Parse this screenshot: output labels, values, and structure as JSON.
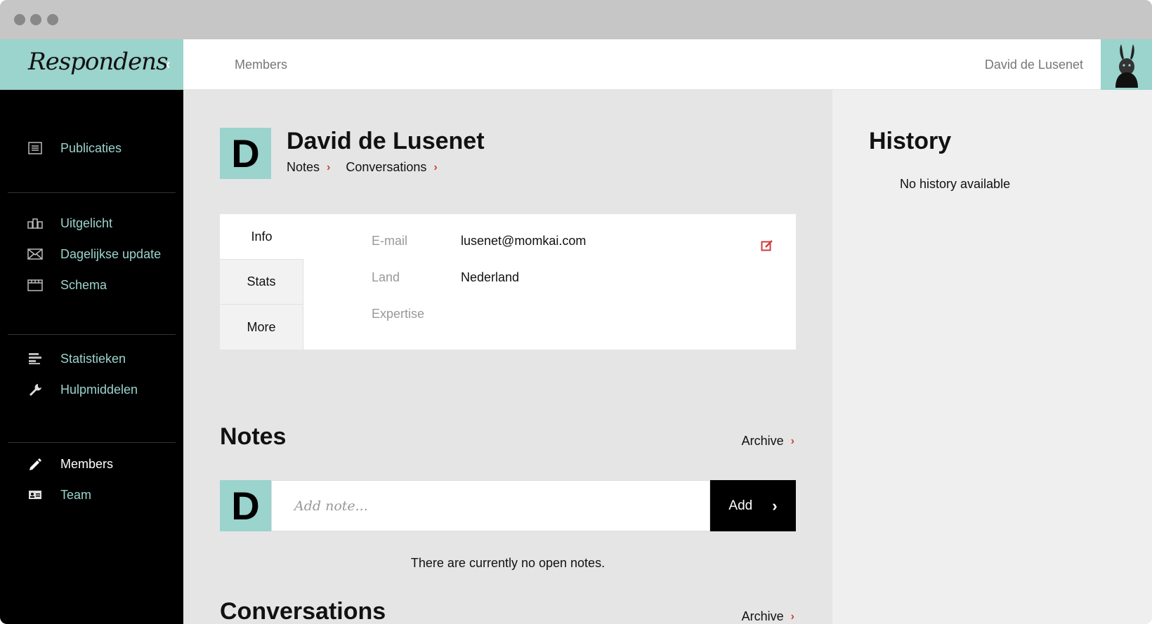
{
  "brand": {
    "logo": "Respondens",
    "collapse_icon": "chevron-left-icon"
  },
  "sidebar": {
    "items": [
      {
        "label": "Publicaties",
        "icon": "list-icon"
      },
      {
        "label": "Uitgelicht",
        "icon": "featured-icon"
      },
      {
        "label": "Dagelijkse update",
        "icon": "mail-icon"
      },
      {
        "label": "Schema",
        "icon": "calendar-icon"
      },
      {
        "label": "Statistieken",
        "icon": "bars-icon"
      },
      {
        "label": "Hulpmiddelen",
        "icon": "wrench-icon"
      },
      {
        "label": "Members",
        "icon": "pencil-icon"
      },
      {
        "label": "Team",
        "icon": "id-card-icon"
      }
    ],
    "active": "Members"
  },
  "header": {
    "breadcrumb": "Members",
    "user_name": "David de Lusenet"
  },
  "profile": {
    "initial": "D",
    "name": "David de Lusenet",
    "links": [
      "Notes",
      "Conversations"
    ]
  },
  "info": {
    "tabs": [
      "Info",
      "Stats",
      "More"
    ],
    "fields": [
      {
        "label": "E-mail",
        "value": "lusenet@momkai.com"
      },
      {
        "label": "Land",
        "value": "Nederland"
      },
      {
        "label": "Expertise",
        "value": ""
      }
    ]
  },
  "notes": {
    "title": "Notes",
    "archive_label": "Archive",
    "input_placeholder": "Add note...",
    "add_label": "Add",
    "empty_text": "There are currently no open notes."
  },
  "conversations": {
    "title": "Conversations",
    "archive_label": "Archive"
  },
  "history": {
    "title": "History",
    "empty_text": "No history available"
  },
  "colors": {
    "accent": "#9bd3cd",
    "link_chevron": "#d23b3b",
    "sidebar_bg": "#000000"
  }
}
